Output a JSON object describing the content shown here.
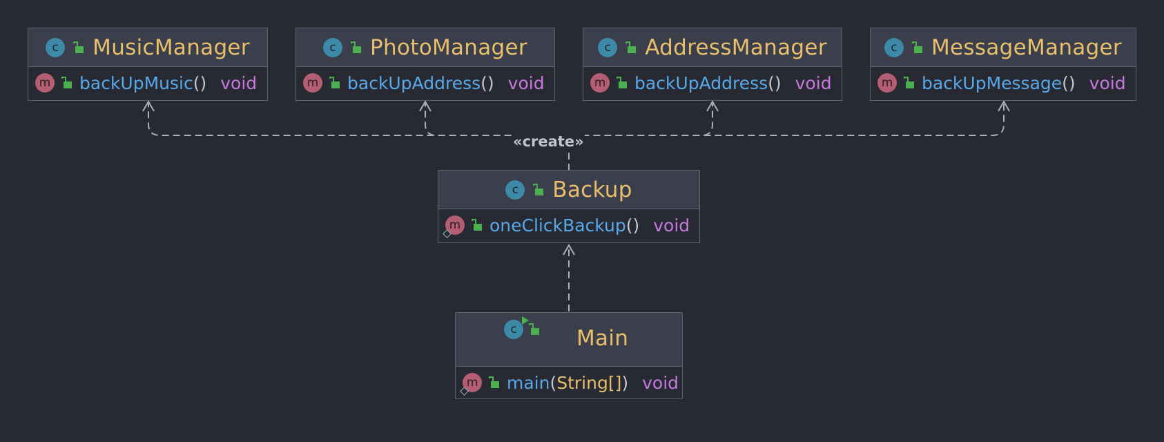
{
  "diagram": {
    "relationship_label": "«create»",
    "classes": {
      "music_manager": {
        "name": "MusicManager",
        "method": "backUpMusic",
        "return_type": "void"
      },
      "photo_manager": {
        "name": "PhotoManager",
        "method": "backUpAddress",
        "return_type": "void"
      },
      "address_manager": {
        "name": "AddressManager",
        "method": "backUpAddress",
        "return_type": "void"
      },
      "message_manager": {
        "name": "MessageManager",
        "method": "backUpMessage",
        "return_type": "void"
      },
      "backup": {
        "name": "Backup",
        "method": "oneClickBackup",
        "return_type": "void"
      },
      "main": {
        "name": "Main",
        "method": "main",
        "param_type": "String[]",
        "return_type": "void"
      }
    },
    "icons": {
      "class_icon_letter": "c",
      "method_icon_letter": "m"
    },
    "colors": {
      "background": "#272a33",
      "class_name": "#e8bf6a",
      "method_name": "#59a8e8",
      "return_type": "#c678dd",
      "class_icon": "#3d8aa8",
      "method_icon": "#b35e72",
      "public_lock": "#4caf50",
      "edge": "#aab0bd"
    }
  }
}
